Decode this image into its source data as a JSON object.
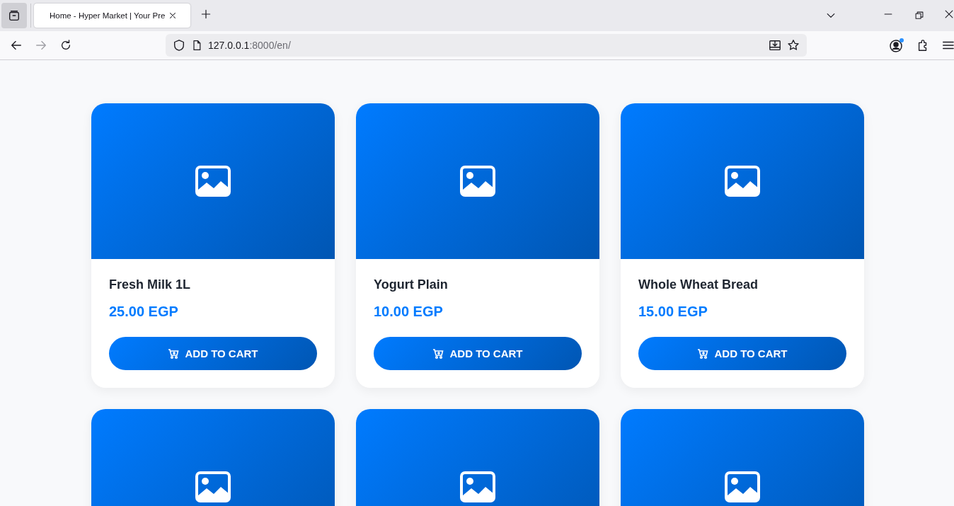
{
  "browser": {
    "tab_title": "Home - Hyper Market | Your Pre",
    "url_host": "127.0.0.1",
    "url_rest": ":8000/en/"
  },
  "products": [
    {
      "name": "Fresh Milk 1L",
      "price": "25.00 EGP",
      "button": "ADD TO CART"
    },
    {
      "name": "Yogurt Plain",
      "price": "10.00 EGP",
      "button": "ADD TO CART"
    },
    {
      "name": "Whole Wheat Bread",
      "price": "15.00 EGP",
      "button": "ADD TO CART"
    },
    {
      "image": {
        "kind": "placeholder"
      }
    },
    {
      "image": {
        "kind": "placeholder"
      }
    },
    {
      "image": {
        "kind": "placeholder"
      }
    }
  ]
}
